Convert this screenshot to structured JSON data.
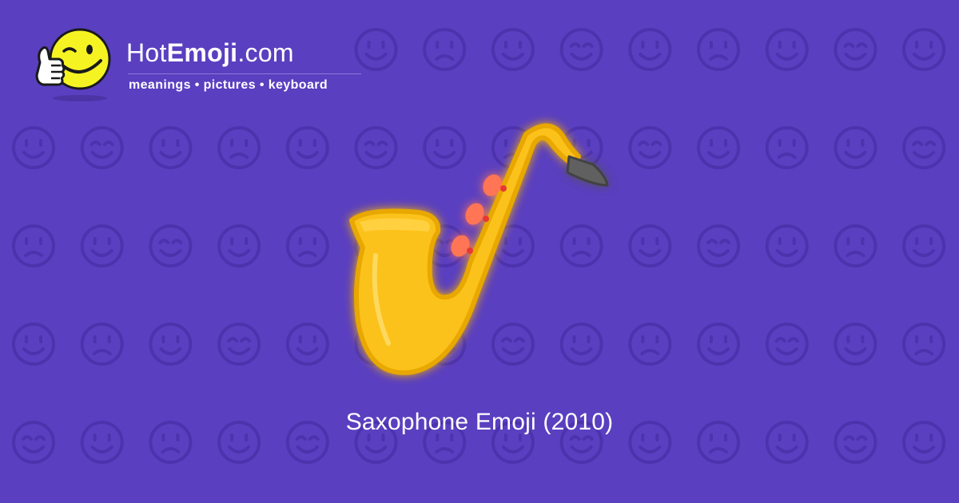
{
  "brand": {
    "title_part1": "Hot",
    "title_part2": "Emoji",
    "title_part3": ".com",
    "tagline": "meanings • pictures • keyboard"
  },
  "emoji": {
    "icon": "saxophone-icon",
    "caption": "Saxophone Emoji (2010)"
  },
  "colors": {
    "background": "#5a3fc0",
    "pattern": "#4c33ad",
    "sax_body": "#fcc21b",
    "sax_keys": "#ff7555",
    "mouthpiece": "#616161",
    "mascot_face": "#f6f323"
  }
}
